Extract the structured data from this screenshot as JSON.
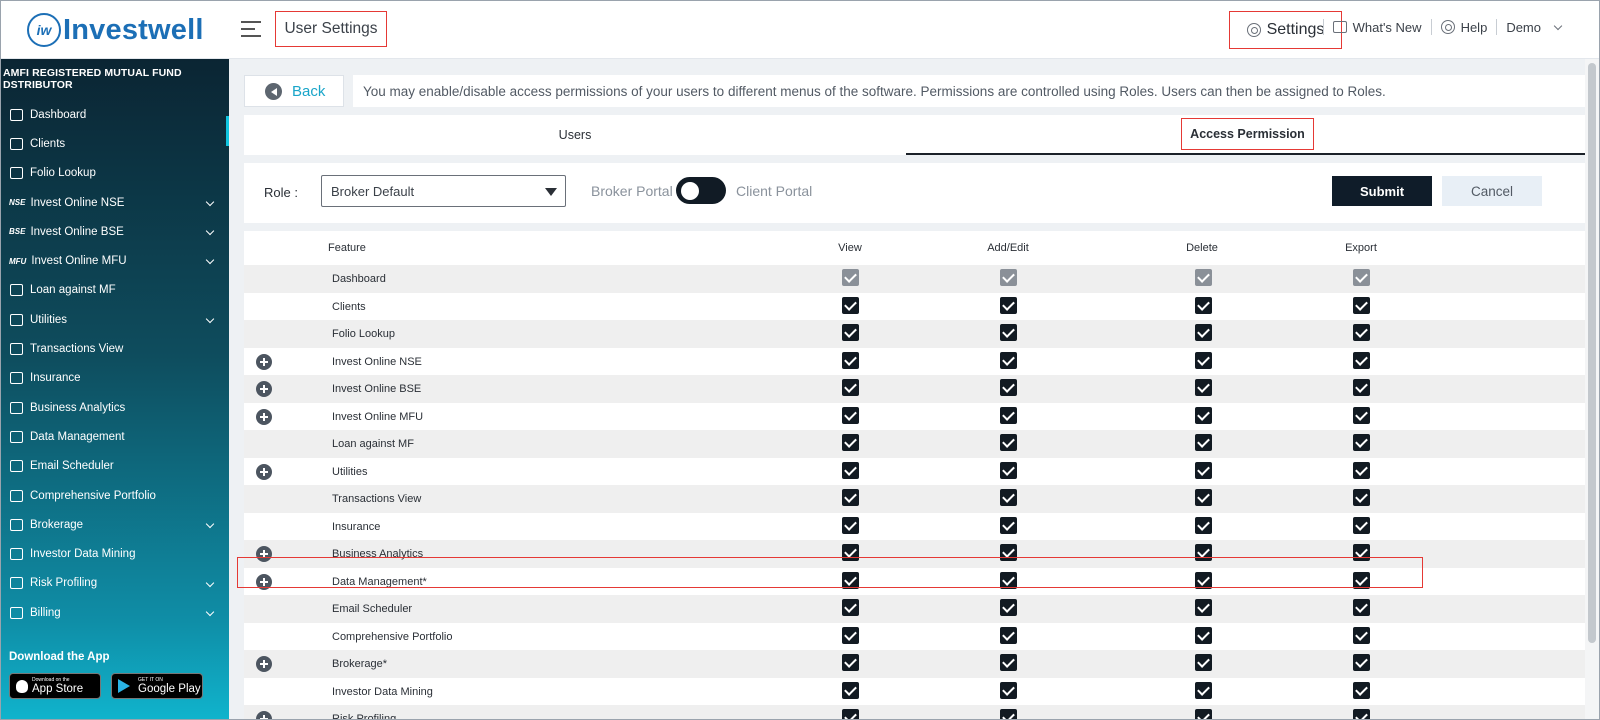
{
  "brand": {
    "logo_mark": "iw",
    "name": "Investwell"
  },
  "header": {
    "page_title": "User Settings",
    "nav": {
      "settings": "Settings",
      "whats_new": "What's New",
      "help": "Help",
      "user": "Demo"
    }
  },
  "sidebar": {
    "registration": "AMFI REGISTERED MUTUAL FUND DSTRIBUTOR",
    "items": [
      {
        "label": "Dashboard",
        "icon": "home-icon",
        "expandable": false
      },
      {
        "label": "Clients",
        "icon": "users-icon",
        "expandable": false
      },
      {
        "label": "Folio Lookup",
        "icon": "rupee-doc-icon",
        "expandable": false
      },
      {
        "label": "Invest Online NSE",
        "icon_text": "NSE",
        "expandable": true
      },
      {
        "label": "Invest Online BSE",
        "icon_text": "BSE",
        "expandable": true
      },
      {
        "label": "Invest Online MFU",
        "icon_text": "MFU",
        "expandable": true
      },
      {
        "label": "Loan against MF",
        "icon": "loan-icon",
        "expandable": false
      },
      {
        "label": "Utilities",
        "icon": "search-icon",
        "expandable": true
      },
      {
        "label": "Transactions View",
        "icon": "transfer-icon",
        "expandable": false
      },
      {
        "label": "Insurance",
        "icon": "document-icon",
        "expandable": false
      },
      {
        "label": "Business Analytics",
        "icon": "chart-icon",
        "expandable": false
      },
      {
        "label": "Data Management",
        "icon": "database-icon",
        "expandable": false
      },
      {
        "label": "Email Scheduler",
        "icon": "mail-icon",
        "expandable": false
      },
      {
        "label": "Comprehensive Portfolio",
        "icon": "briefcase-icon",
        "expandable": false
      },
      {
        "label": "Brokerage",
        "icon": "percent-icon",
        "expandable": true
      },
      {
        "label": "Investor Data Mining",
        "icon": "rupee-icon",
        "expandable": false
      },
      {
        "label": "Risk Profiling",
        "icon": "gauge-icon",
        "expandable": true
      },
      {
        "label": "Billing",
        "icon": "bill-icon",
        "expandable": true
      }
    ],
    "download_title": "Download the App",
    "app_store": {
      "small": "Download on the",
      "large": "App Store"
    },
    "google_play": {
      "small": "GET IT ON",
      "large": "Google Play"
    }
  },
  "main": {
    "back_label": "Back",
    "info": "You may enable/disable access permissions of your users to different menus of the software. Permissions are controlled using Roles. Users can then be assigned to Roles.",
    "tabs": [
      {
        "label": "Users",
        "active": false
      },
      {
        "label": "Access Permission",
        "active": true
      }
    ],
    "role_label": "Role :",
    "role_value": "Broker Default",
    "portal_left": "Broker Portal",
    "portal_right": "Client Portal",
    "submit_label": "Submit",
    "cancel_label": "Cancel"
  },
  "permissions_table": {
    "columns": [
      "Feature",
      "View",
      "Add/Edit",
      "Delete",
      "Export"
    ],
    "rows": [
      {
        "feature": "Dashboard",
        "expandable": false,
        "checked": [
          true,
          true,
          true,
          true
        ],
        "disabled": true
      },
      {
        "feature": "Clients",
        "expandable": false,
        "checked": [
          true,
          true,
          true,
          true
        ],
        "disabled": false
      },
      {
        "feature": "Folio Lookup",
        "expandable": false,
        "checked": [
          true,
          true,
          true,
          true
        ],
        "disabled": false
      },
      {
        "feature": "Invest Online NSE",
        "expandable": true,
        "checked": [
          true,
          true,
          true,
          true
        ],
        "disabled": false
      },
      {
        "feature": "Invest Online BSE",
        "expandable": true,
        "checked": [
          true,
          true,
          true,
          true
        ],
        "disabled": false
      },
      {
        "feature": "Invest Online MFU",
        "expandable": true,
        "checked": [
          true,
          true,
          true,
          true
        ],
        "disabled": false
      },
      {
        "feature": "Loan against MF",
        "expandable": false,
        "checked": [
          true,
          true,
          true,
          true
        ],
        "disabled": false
      },
      {
        "feature": "Utilities",
        "expandable": true,
        "checked": [
          true,
          true,
          true,
          true
        ],
        "disabled": false
      },
      {
        "feature": "Transactions View",
        "expandable": false,
        "checked": [
          true,
          true,
          true,
          true
        ],
        "disabled": false
      },
      {
        "feature": "Insurance",
        "expandable": false,
        "checked": [
          true,
          true,
          true,
          true
        ],
        "disabled": false
      },
      {
        "feature": "Business Analytics",
        "expandable": true,
        "checked": [
          true,
          true,
          true,
          true
        ],
        "disabled": false
      },
      {
        "feature": "Data Management*",
        "expandable": true,
        "checked": [
          true,
          true,
          true,
          true
        ],
        "disabled": false
      },
      {
        "feature": "Email Scheduler",
        "expandable": false,
        "checked": [
          true,
          true,
          true,
          true
        ],
        "disabled": false
      },
      {
        "feature": "Comprehensive Portfolio",
        "expandable": false,
        "checked": [
          true,
          true,
          true,
          true
        ],
        "disabled": false
      },
      {
        "feature": "Brokerage*",
        "expandable": true,
        "checked": [
          true,
          true,
          true,
          true
        ],
        "disabled": false
      },
      {
        "feature": "Investor Data Mining",
        "expandable": false,
        "checked": [
          true,
          true,
          true,
          true
        ],
        "disabled": false
      },
      {
        "feature": "Risk Profiling",
        "expandable": true,
        "checked": [
          true,
          true,
          true,
          true
        ],
        "disabled": false
      }
    ]
  },
  "colors": {
    "accent": "#1c6fb6",
    "highlight": "#e53935",
    "link": "#1aa5c9",
    "dark": "#0f1c29"
  }
}
